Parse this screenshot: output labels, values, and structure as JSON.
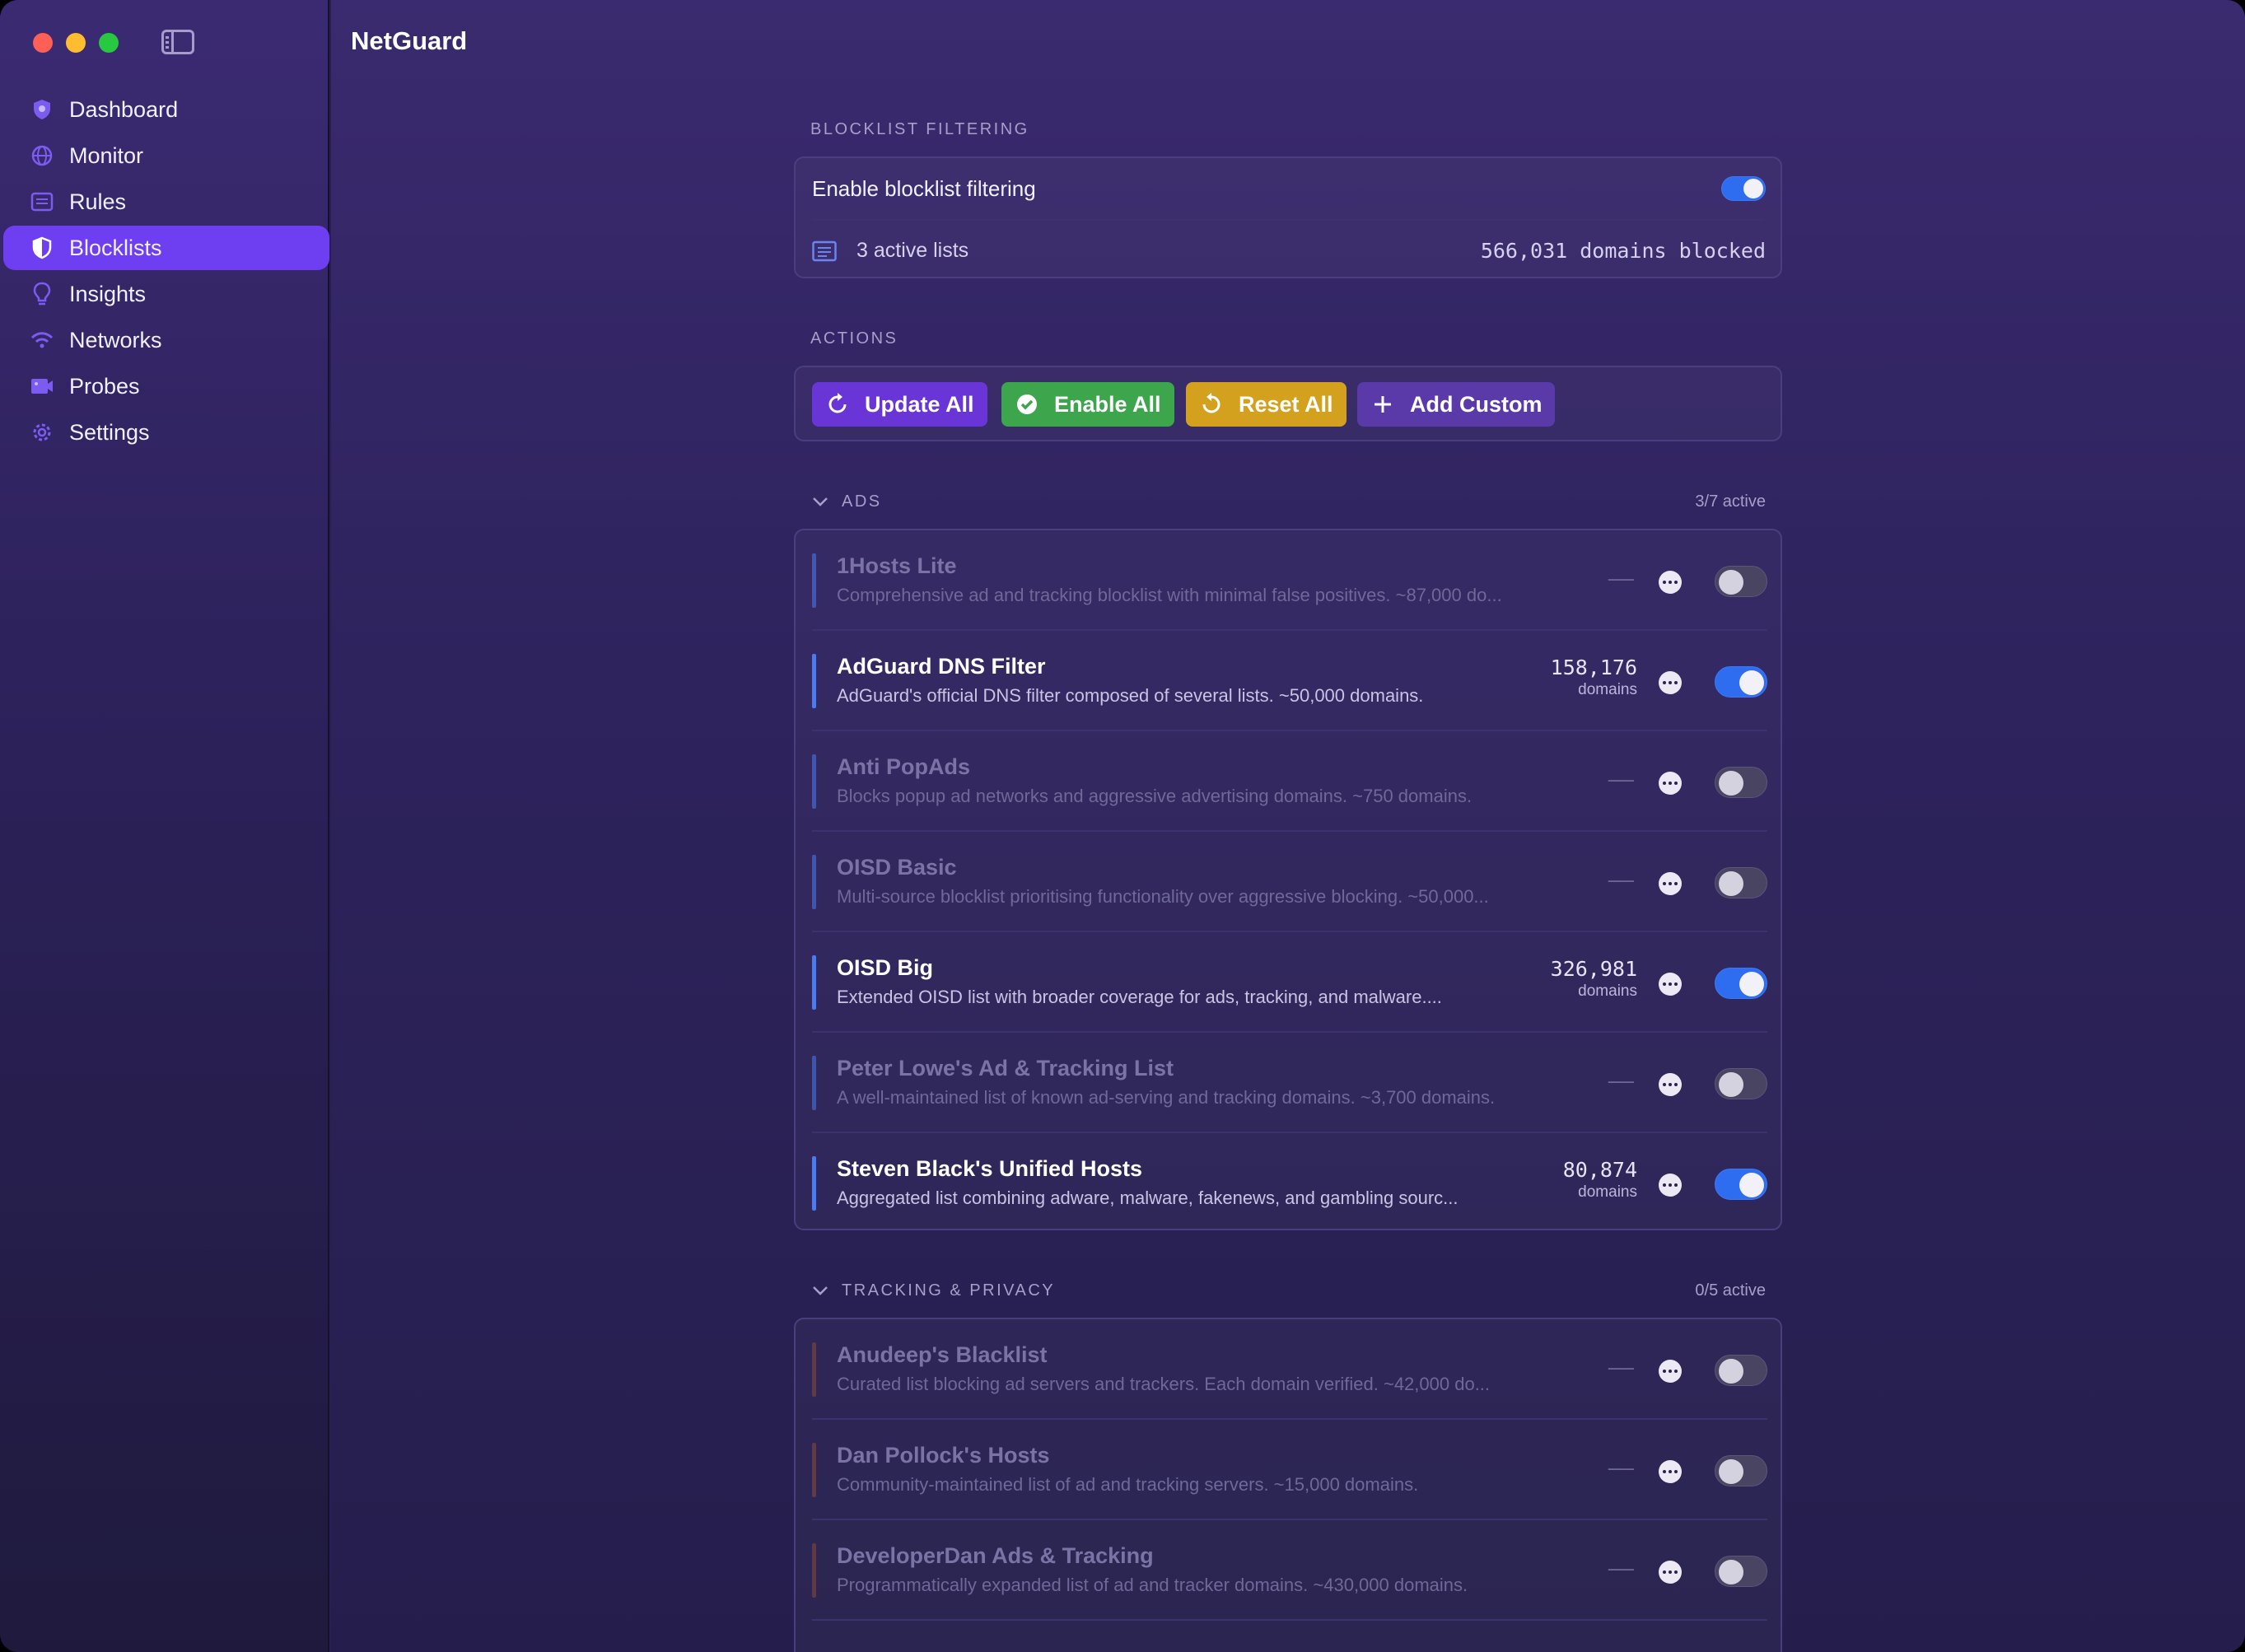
{
  "app": {
    "title": "NetGuard"
  },
  "sidebar": {
    "items": [
      {
        "label": "Dashboard",
        "icon": "shield-shape-icon",
        "active": false
      },
      {
        "label": "Monitor",
        "icon": "globe-icon",
        "active": false
      },
      {
        "label": "Rules",
        "icon": "list-rules-icon",
        "active": false
      },
      {
        "label": "Blocklists",
        "icon": "half-shield-icon",
        "active": true
      },
      {
        "label": "Insights",
        "icon": "lightbulb-icon",
        "active": false
      },
      {
        "label": "Networks",
        "icon": "wifi-icon",
        "active": false
      },
      {
        "label": "Probes",
        "icon": "probe-camera-icon",
        "active": false
      },
      {
        "label": "Settings",
        "icon": "gear-icon",
        "active": false
      }
    ]
  },
  "filtering": {
    "section_label": "BLOCKLIST FILTERING",
    "enable_label": "Enable blocklist filtering",
    "enabled": true,
    "active_lists": "3 active lists",
    "domains_blocked": "566,031 domains blocked"
  },
  "actions": {
    "section_label": "ACTIONS",
    "update_all": "Update All",
    "enable_all": "Enable All",
    "reset_all": "Reset All",
    "add_custom": "Add Custom",
    "colors": {
      "update": "#6a35d6",
      "enable": "#3da54c",
      "reset": "#d4a11f",
      "add": "#5a3aa8"
    }
  },
  "groups": [
    {
      "title": "ADS",
      "count": "3/7 active",
      "accent": "#4b7bf0",
      "lists": [
        {
          "name": "1Hosts Lite",
          "desc": "Comprehensive ad and tracking blocklist with minimal false positives. ~87,000 do...",
          "count": "——",
          "unit": "",
          "on": false
        },
        {
          "name": "AdGuard DNS Filter",
          "desc": "AdGuard's official DNS filter composed of several lists. ~50,000 domains.",
          "count": "158,176",
          "unit": "domains",
          "on": true
        },
        {
          "name": "Anti PopAds",
          "desc": "Blocks popup ad networks and aggressive advertising domains. ~750 domains.",
          "count": "——",
          "unit": "",
          "on": false
        },
        {
          "name": "OISD Basic",
          "desc": "Multi-source blocklist prioritising functionality over aggressive blocking. ~50,000...",
          "count": "——",
          "unit": "",
          "on": false
        },
        {
          "name": "OISD Big",
          "desc": "Extended OISD list with broader coverage for ads, tracking, and malware....",
          "count": "326,981",
          "unit": "domains",
          "on": true
        },
        {
          "name": "Peter Lowe's Ad & Tracking List",
          "desc": "A well-maintained list of known ad-serving and tracking domains. ~3,700 domains.",
          "count": "——",
          "unit": "",
          "on": false
        },
        {
          "name": "Steven Black's Unified Hosts",
          "desc": "Aggregated list combining adware, malware, fakenews, and gambling sourc...",
          "count": "80,874",
          "unit": "domains",
          "on": true
        }
      ]
    },
    {
      "title": "TRACKING & PRIVACY",
      "count": "0/5 active",
      "accent": "#8a4a3a",
      "lists": [
        {
          "name": "Anudeep's Blacklist",
          "desc": "Curated list blocking ad servers and trackers. Each domain verified. ~42,000 do...",
          "count": "——",
          "unit": "",
          "on": false
        },
        {
          "name": "Dan Pollock's Hosts",
          "desc": "Community-maintained list of ad and tracking servers. ~15,000 domains.",
          "count": "——",
          "unit": "",
          "on": false
        },
        {
          "name": "DeveloperDan Ads & Tracking",
          "desc": "Programmatically expanded list of ad and tracker domains. ~430,000 domains.",
          "count": "——",
          "unit": "",
          "on": false
        }
      ]
    }
  ]
}
